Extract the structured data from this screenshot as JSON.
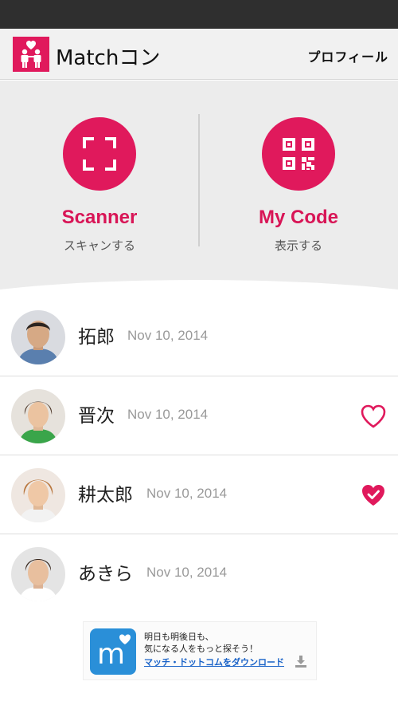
{
  "app": {
    "title": "Matchコン",
    "profile_label": "プロフィール"
  },
  "hero": {
    "scanner": {
      "label": "Scanner",
      "sub": "スキャンする",
      "icon": "scan-frame-icon"
    },
    "mycode": {
      "label": "My Code",
      "sub": "表示する",
      "icon": "qr-code-icon"
    }
  },
  "contacts": [
    {
      "name": "拓郎",
      "date": "Nov 10, 2014",
      "heart": "none"
    },
    {
      "name": "晋次",
      "date": "Nov 10, 2014",
      "heart": "outline"
    },
    {
      "name": "耕太郎",
      "date": "Nov 10, 2014",
      "heart": "filled-check"
    },
    {
      "name": "あきら",
      "date": "Nov 10, 2014",
      "heart": "none"
    }
  ],
  "ad": {
    "line1": "明日も明後日も、",
    "line2": "気になる人をもっと探そう！",
    "link": "マッチ・ドットコムをダウンロード"
  },
  "colors": {
    "accent": "#e0195c",
    "accent_text": "#d81556",
    "statusbar": "#2f2f2f"
  }
}
